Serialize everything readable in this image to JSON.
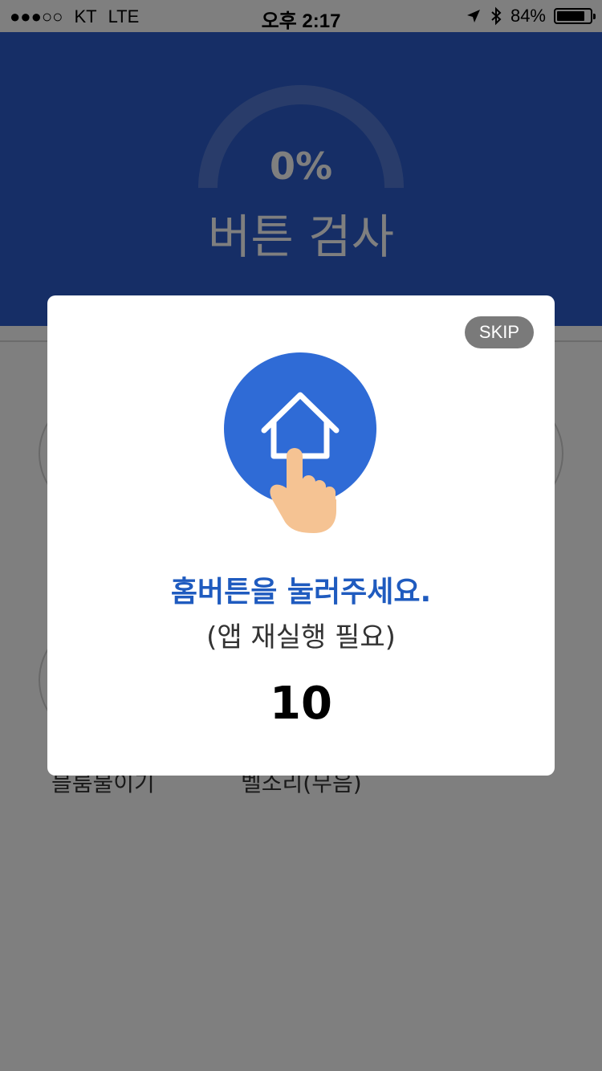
{
  "status_bar": {
    "signal": "●●●○○",
    "carrier": "KT",
    "network": "LTE",
    "time": "오후 2:17",
    "battery_percent": "84%",
    "battery_level": 0.84,
    "icons": [
      "location-arrow-icon",
      "bluetooth-icon",
      "battery-icon"
    ]
  },
  "header": {
    "progress_text": "0%",
    "progress_value": 0,
    "title": "버튼 검사",
    "color": "#2c5ccc"
  },
  "background_items": [
    {
      "label": "블룸불이기"
    },
    {
      "label": "벨소리(무음)"
    }
  ],
  "modal": {
    "skip_label": "SKIP",
    "illustration_icon": "home-button-press-icon",
    "message_main": "홈버튼을 눌러주세요.",
    "message_sub": "(앱 재실행 필요)",
    "countdown": "10",
    "accent_color": "#2f6bd6"
  }
}
